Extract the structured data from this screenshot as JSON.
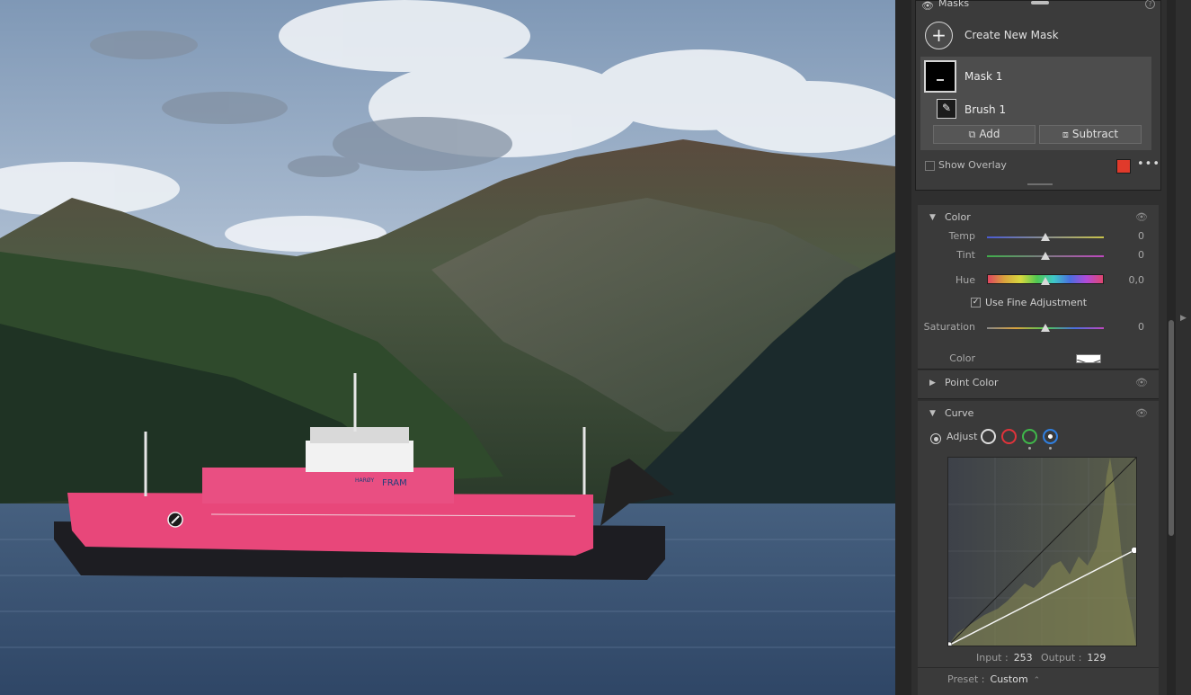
{
  "masks": {
    "title": "Masks",
    "create_label": "Create New Mask",
    "mask_name": "Mask 1",
    "brush_name": "Brush 1",
    "add_label": "Add",
    "subtract_label": "Subtract",
    "show_overlay_label": "Show Overlay",
    "overlay_color": "#e03a2b",
    "help_glyph": "?",
    "more_glyph": "•••"
  },
  "color_section": {
    "title": "Color",
    "sliders": [
      {
        "label": "Temp",
        "value": "0"
      },
      {
        "label": "Tint",
        "value": "0"
      },
      {
        "label": "Hue",
        "value": "0,0"
      },
      {
        "label": "Saturation",
        "value": "0"
      }
    ],
    "fine_adjust_label": "Use Fine Adjustment",
    "fine_adjust_checked": true,
    "color_label": "Color"
  },
  "point_color": {
    "title": "Point Color"
  },
  "curve": {
    "title": "Curve",
    "adjust_label": "Adjust",
    "channels": [
      "white",
      "red",
      "green",
      "blue"
    ],
    "active_channel": "blue",
    "input_label": "Input :",
    "input_value": "253",
    "output_label": "Output :",
    "output_value": "129",
    "preset_label": "Preset :",
    "preset_value": "Custom"
  },
  "photo": {
    "ship_name": "FRAM",
    "ship_name_small": "HARØY"
  },
  "icons": {
    "eye": "eye-icon",
    "help": "help-icon",
    "plus": "plus-icon",
    "brush": "brush-icon",
    "add": "add-mask-icon",
    "subtract": "subtract-mask-icon",
    "disclosure_open": "triangle-down-icon",
    "disclosure_closed": "triangle-right-icon"
  },
  "colors": {
    "panel_bg": "#3a3a3a",
    "overlay_red": "#e03a2b",
    "active_channel": "#2f7fe0"
  }
}
